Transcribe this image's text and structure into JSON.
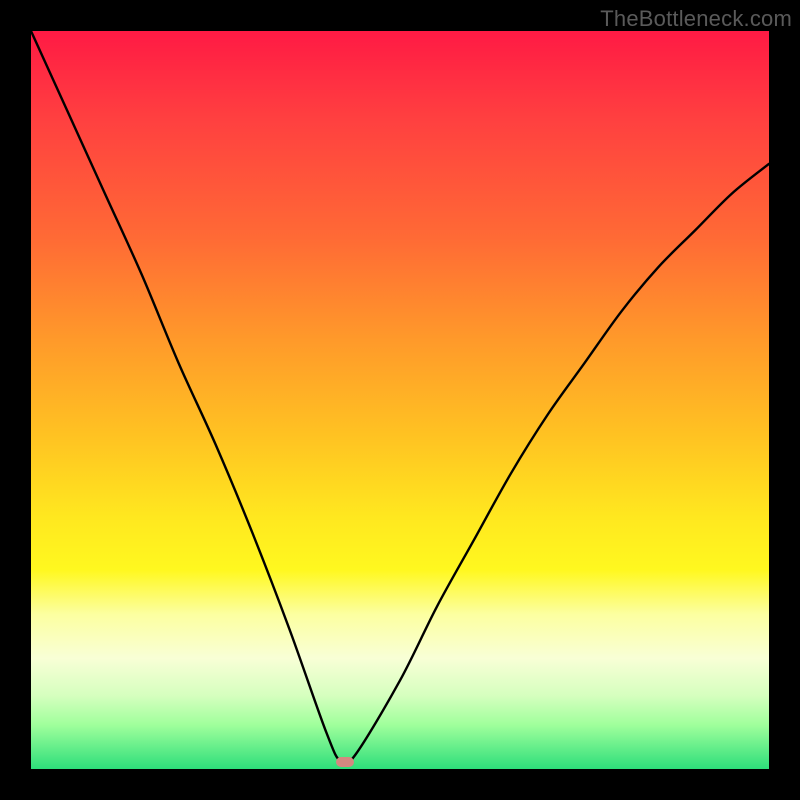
{
  "watermark": "TheBottleneck.com",
  "colors": {
    "gradient_top": "#ff1a44",
    "gradient_bottom": "#2dde7a",
    "curve": "#000000",
    "marker": "#d48880",
    "frame": "#000000"
  },
  "marker": {
    "x_pct": 42.5,
    "y_pct": 99.0
  },
  "chart_data": {
    "type": "line",
    "title": "",
    "xlabel": "",
    "ylabel": "",
    "xlim": [
      0,
      100
    ],
    "ylim": [
      0,
      100
    ],
    "series": [
      {
        "name": "bottleneck-curve",
        "x": [
          0,
          5,
          10,
          15,
          20,
          25,
          30,
          35,
          40,
          42,
          44,
          50,
          55,
          60,
          65,
          70,
          75,
          80,
          85,
          90,
          95,
          100
        ],
        "y": [
          100,
          89,
          78,
          67,
          55,
          44,
          32,
          19,
          5,
          1,
          2,
          12,
          22,
          31,
          40,
          48,
          55,
          62,
          68,
          73,
          78,
          82
        ]
      }
    ],
    "annotations": [
      {
        "text": "TheBottleneck.com",
        "role": "watermark",
        "position": "top-right"
      }
    ],
    "background_gradient": {
      "type": "vertical",
      "stops": [
        {
          "pct": 0,
          "color": "#ff1a44"
        },
        {
          "pct": 50,
          "color": "#ffc322"
        },
        {
          "pct": 75,
          "color": "#fcffa0"
        },
        {
          "pct": 100,
          "color": "#2dde7a"
        }
      ]
    }
  }
}
